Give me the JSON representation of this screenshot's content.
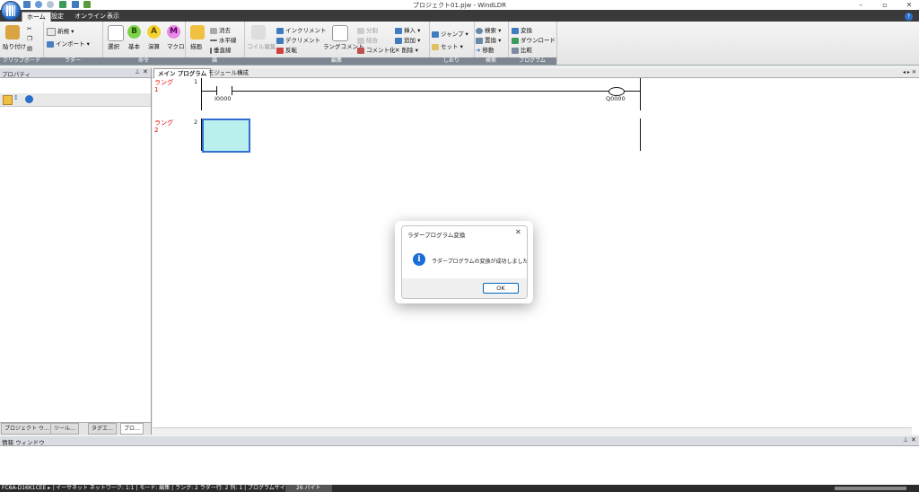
{
  "window": {
    "title": "プロジェクト01.pjw - WindLDR",
    "help_icon": "help-icon"
  },
  "ribbon_tabs": [
    "ホーム",
    "設定",
    "オンライン",
    "表示"
  ],
  "ribbon": {
    "clipboard": {
      "label": "クリップボード",
      "paste": "貼り付け"
    },
    "ladder": {
      "label": "ラダー",
      "new": "新規",
      "import": "インポート"
    },
    "instructions": {
      "label": "命令",
      "select": "選択",
      "basic": "基本",
      "advanced": "演算",
      "macro": "マクロ"
    },
    "draw": {
      "label": "描",
      "draw": "描画",
      "erase": "消去",
      "horizontal": "水平線",
      "vertical": "垂直線"
    },
    "edit": {
      "label": "編集",
      "coil_edit": "コイル編集",
      "increment": "インクリメント",
      "decrement": "デクリメント",
      "invert": "反転",
      "rung_comment": "ラングコメント",
      "split": "分割",
      "join": "結合",
      "insert": "挿入",
      "add": "追加",
      "delete": "削除",
      "comment": "コメント化"
    },
    "bookmark": {
      "label": "しおり",
      "jump": "ジャンプ",
      "set": "セット"
    },
    "search": {
      "label": "検索",
      "search": "検索",
      "replace": "置換",
      "move": "移動"
    },
    "program": {
      "label": "プログラム",
      "convert": "変換",
      "download": "ダウンロード",
      "compare": "比較"
    }
  },
  "properties_panel": {
    "title": "プロパティ",
    "tabs": [
      "プロジェクト ウ…",
      "ツール…",
      "タグエ…",
      "ブロ…"
    ]
  },
  "document_tabs": [
    "メイン プログラム",
    "モジュール構成"
  ],
  "ladder": {
    "rungs": [
      {
        "label": "ラング",
        "number": "1",
        "index": "1",
        "contact": "I0000",
        "coil": "Q0000"
      },
      {
        "label": "ラング",
        "number": "2",
        "index": "2"
      }
    ]
  },
  "info_window": {
    "title": "情報 ウィンドウ"
  },
  "dialog": {
    "title": "ラダープログラム変換",
    "message": "ラダープログラムの変換が成功しました。",
    "ok": "OK",
    "icon_letter": "i"
  },
  "statusbar": {
    "text": "FC6A-D16K1CEE  ▸ | イーサネット  ネットワーク: 1:1 | モード: 編集 | ラング: 2  ラダー行: 2  列: 1 | プログラムサイズ:",
    "size": "26 バイト"
  },
  "colors": {
    "accent": "#2a6fc9",
    "rung_label": "#ee0000",
    "selection": "#b9f0ee"
  }
}
